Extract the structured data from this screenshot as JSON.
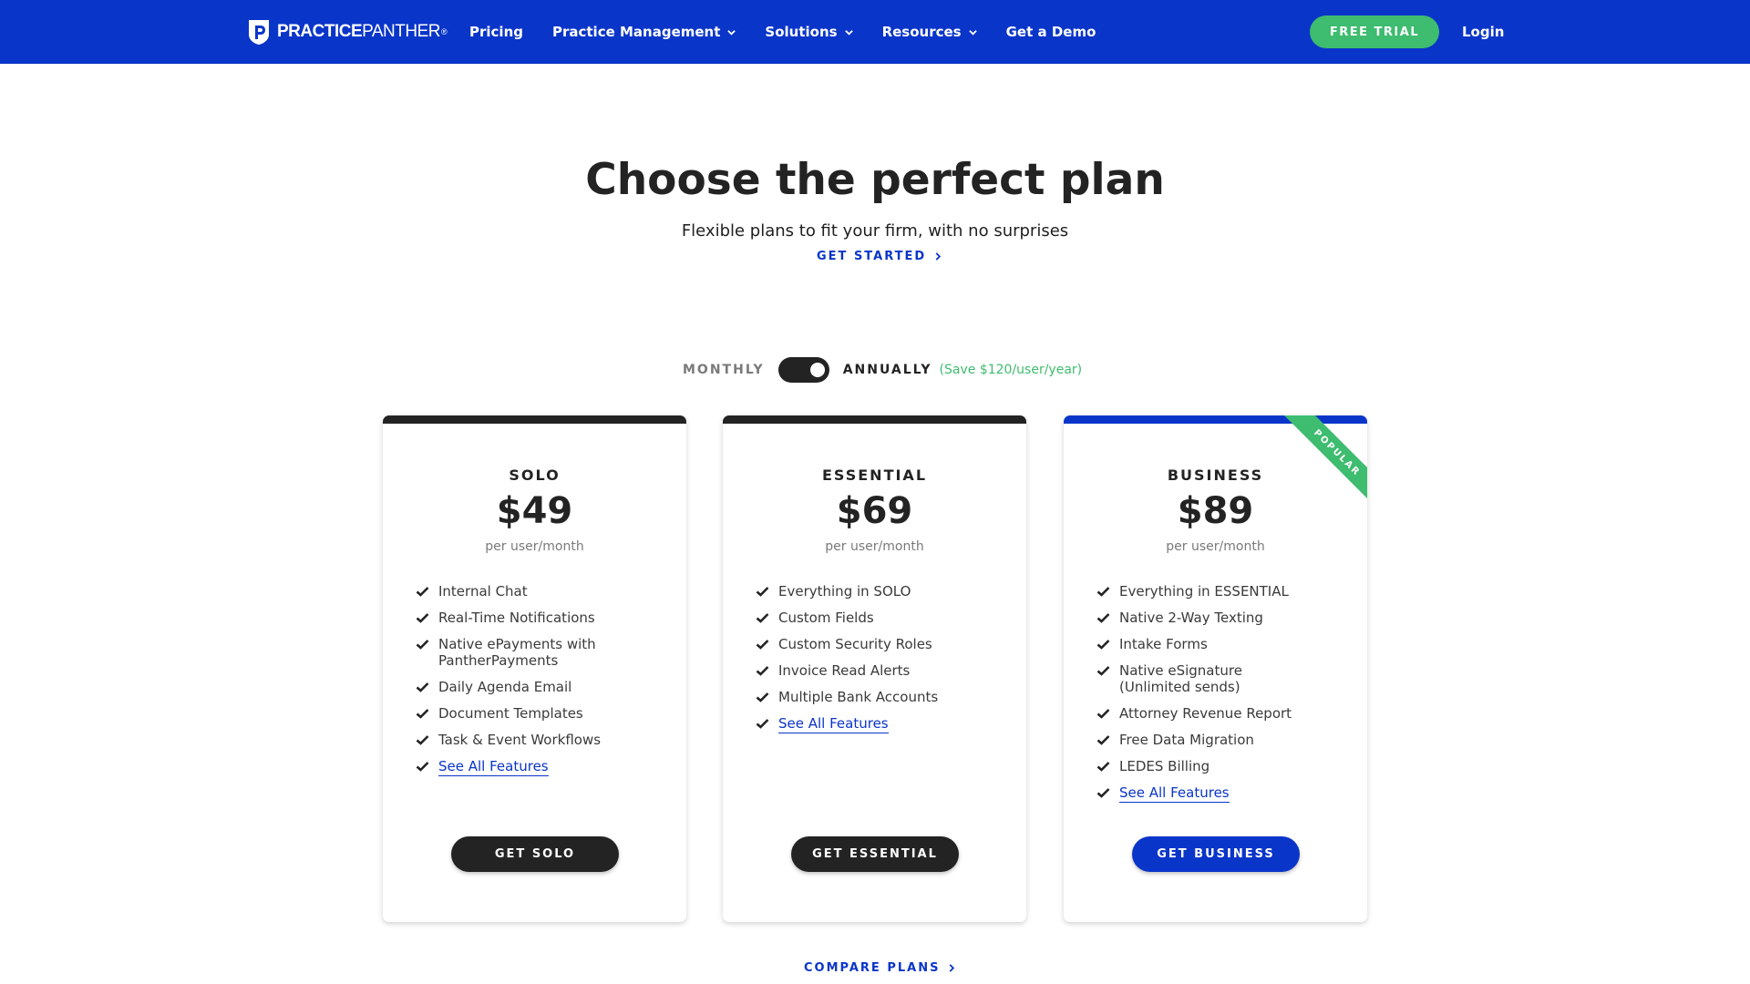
{
  "brand": {
    "name_bold": "PRACTICE",
    "name_light": "PANTHER",
    "registered": "®",
    "primary_color": "#0a35c9",
    "accent_color": "#3ebc6f",
    "dark_color": "#232323"
  },
  "nav": {
    "links": [
      {
        "label": "Pricing",
        "has_dropdown": false
      },
      {
        "label": "Practice Management",
        "has_dropdown": true
      },
      {
        "label": "Solutions",
        "has_dropdown": true
      },
      {
        "label": "Resources",
        "has_dropdown": true
      },
      {
        "label": "Get a Demo",
        "has_dropdown": false
      }
    ],
    "free_trial": "FREE TRIAL",
    "login": "Login"
  },
  "hero": {
    "title": "Choose the perfect plan",
    "subtitle": "Flexible plans to fit your firm, with no surprises",
    "cta": "GET STARTED"
  },
  "billing": {
    "monthly": "MONTHLY",
    "annually": "ANNUALLY",
    "save": "(Save $120/user/year)",
    "selected": "ANNUALLY"
  },
  "plans": [
    {
      "name": "SOLO",
      "price": "$49",
      "per": "per user/month",
      "features": [
        "Internal Chat",
        "Real-Time Notifications",
        "Native ePayments with PantherPayments",
        "Daily Agenda Email",
        "Document Templates",
        "Task & Event Workflows"
      ],
      "see_all": "See All Features",
      "button": "GET SOLO"
    },
    {
      "name": "ESSENTIAL",
      "price": "$69",
      "per": "per user/month",
      "features": [
        "Everything in SOLO",
        "Custom Fields",
        "Custom Security Roles",
        "Invoice Read Alerts",
        "Multiple Bank Accounts"
      ],
      "see_all": "See All Features",
      "button": "GET ESSENTIAL"
    },
    {
      "name": "BUSINESS",
      "price": "$89",
      "per": "per user/month",
      "badge": "POPULAR",
      "features": [
        "Everything in ESSENTIAL",
        "Native 2-Way Texting",
        "Intake Forms",
        "Native eSignature (Unlimited sends)",
        "Attorney Revenue Report",
        "Free Data Migration",
        "LEDES Billing"
      ],
      "see_all": "See All Features",
      "button": "GET BUSINESS"
    }
  ],
  "compare": "COMPARE PLANS"
}
